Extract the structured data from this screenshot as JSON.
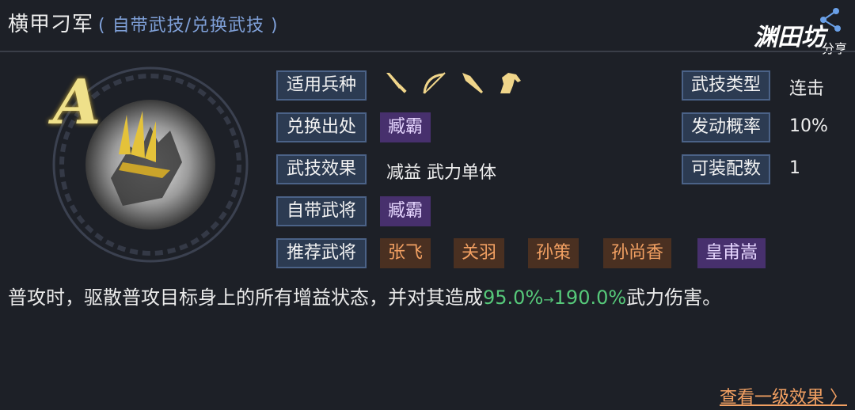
{
  "header": {
    "title": "横甲刁军",
    "subtitle": "( 自带武技/兑换武技 )",
    "brand_logo": "渊田坊",
    "brand_share": "分享"
  },
  "grade": "A",
  "rows": {
    "troop_label": "适用兵种",
    "troop_icons": [
      "sword-icon",
      "bow-icon",
      "spear-icon",
      "horse-icon"
    ],
    "exchange_label": "兑换出处",
    "exchange_value": "臧霸",
    "effect_label": "武技效果",
    "effect_value": "减益 武力单体",
    "builtin_label": "自带武将",
    "builtin_value": "臧霸",
    "recommend_label": "推荐武将",
    "recommend": [
      {
        "name": "张飞",
        "color": "orange"
      },
      {
        "name": "关羽",
        "color": "orange"
      },
      {
        "name": "孙策",
        "color": "orange"
      },
      {
        "name": "孙尚香",
        "color": "orange"
      },
      {
        "name": "皇甫嵩",
        "color": "purple"
      }
    ]
  },
  "stats": {
    "type_label": "武技类型",
    "type_value": "连击",
    "rate_label": "发动概率",
    "rate_value": "10%",
    "equip_label": "可装配数",
    "equip_value": "1"
  },
  "description": {
    "prefix": "普攻时，驱散普攻目标身上的所有增益状态，并对其造成",
    "from": "95.0%",
    "arrow": "→",
    "to": "190.0%",
    "suffix": "武力伤害。"
  },
  "footer": {
    "more_label": "查看一级效果 〉"
  },
  "colors": {
    "background": "#1d2027",
    "label_bg": "#2c3b52",
    "purple_chip": "#47306d",
    "orange_chip": "#4a3021",
    "orange_text": "#f2a062",
    "green_text": "#56c97a"
  }
}
